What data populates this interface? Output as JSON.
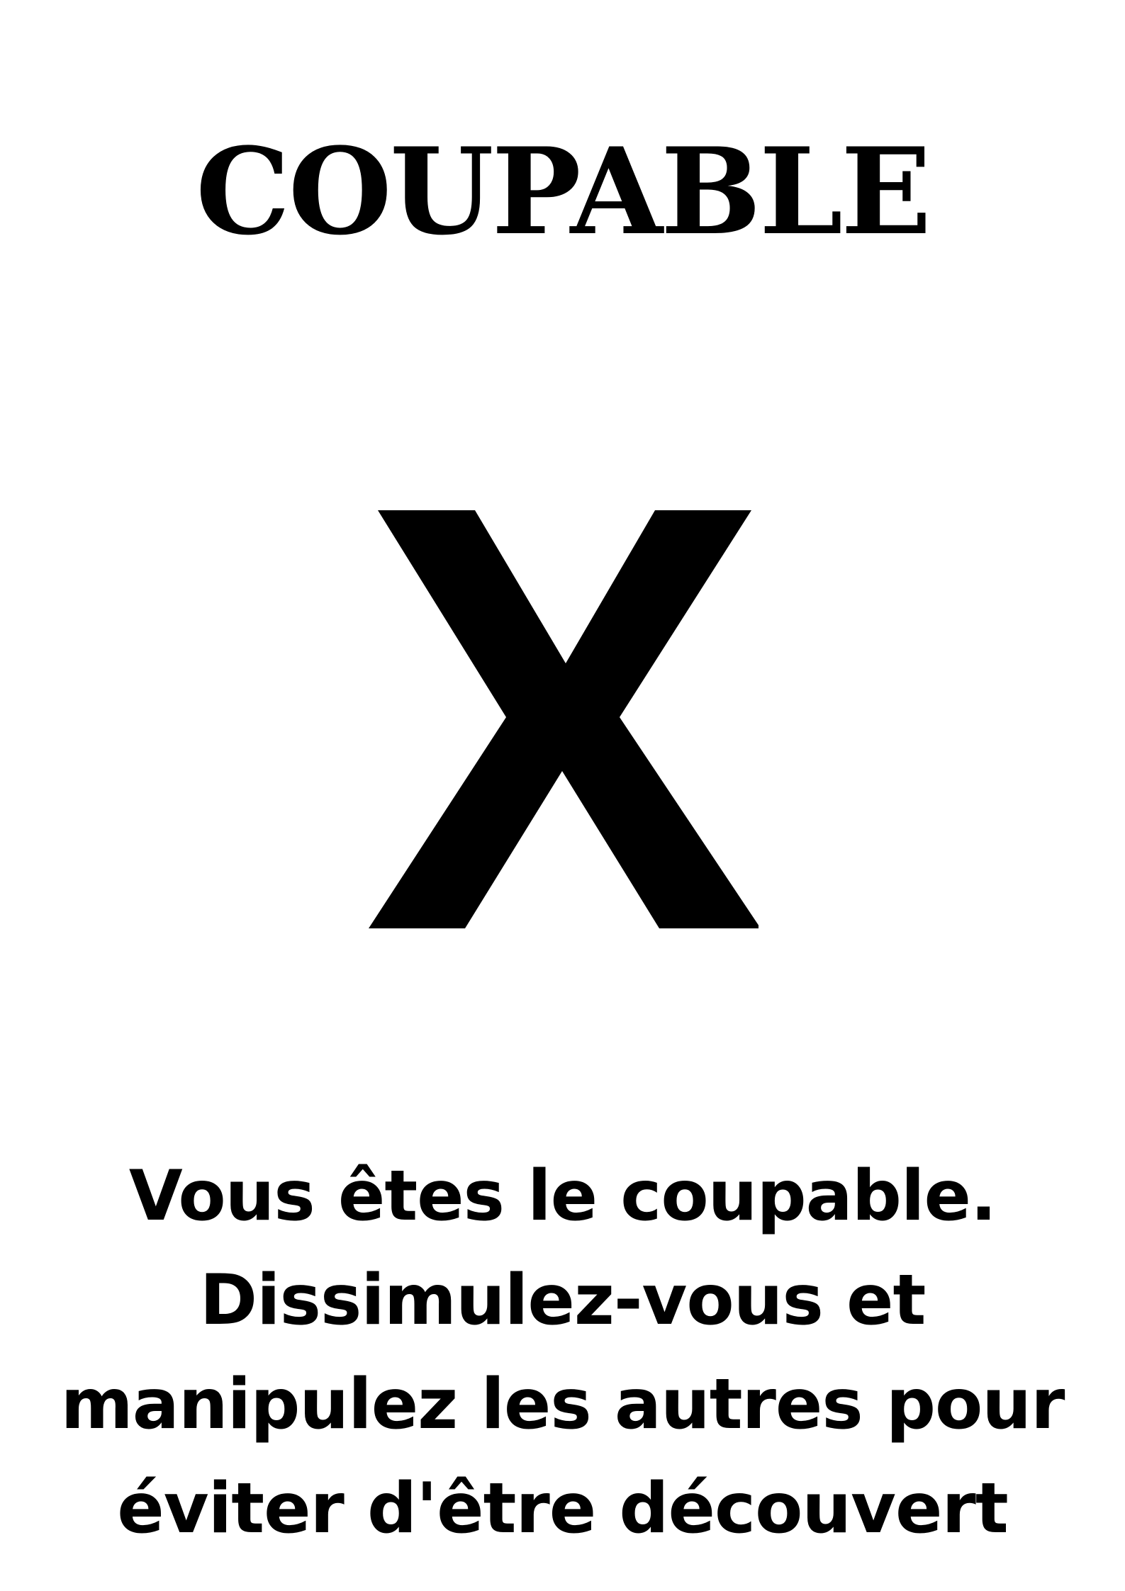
{
  "card": {
    "title": "COUPABLE",
    "symbol_icon": "x-icon",
    "description_lines": [
      "Vous êtes le coupable.",
      "Dissimulez-vous et",
      "manipulez les autres pour",
      "éviter d'être découvert"
    ]
  },
  "colors": {
    "background": "#ffffff",
    "ink": "#000000"
  }
}
